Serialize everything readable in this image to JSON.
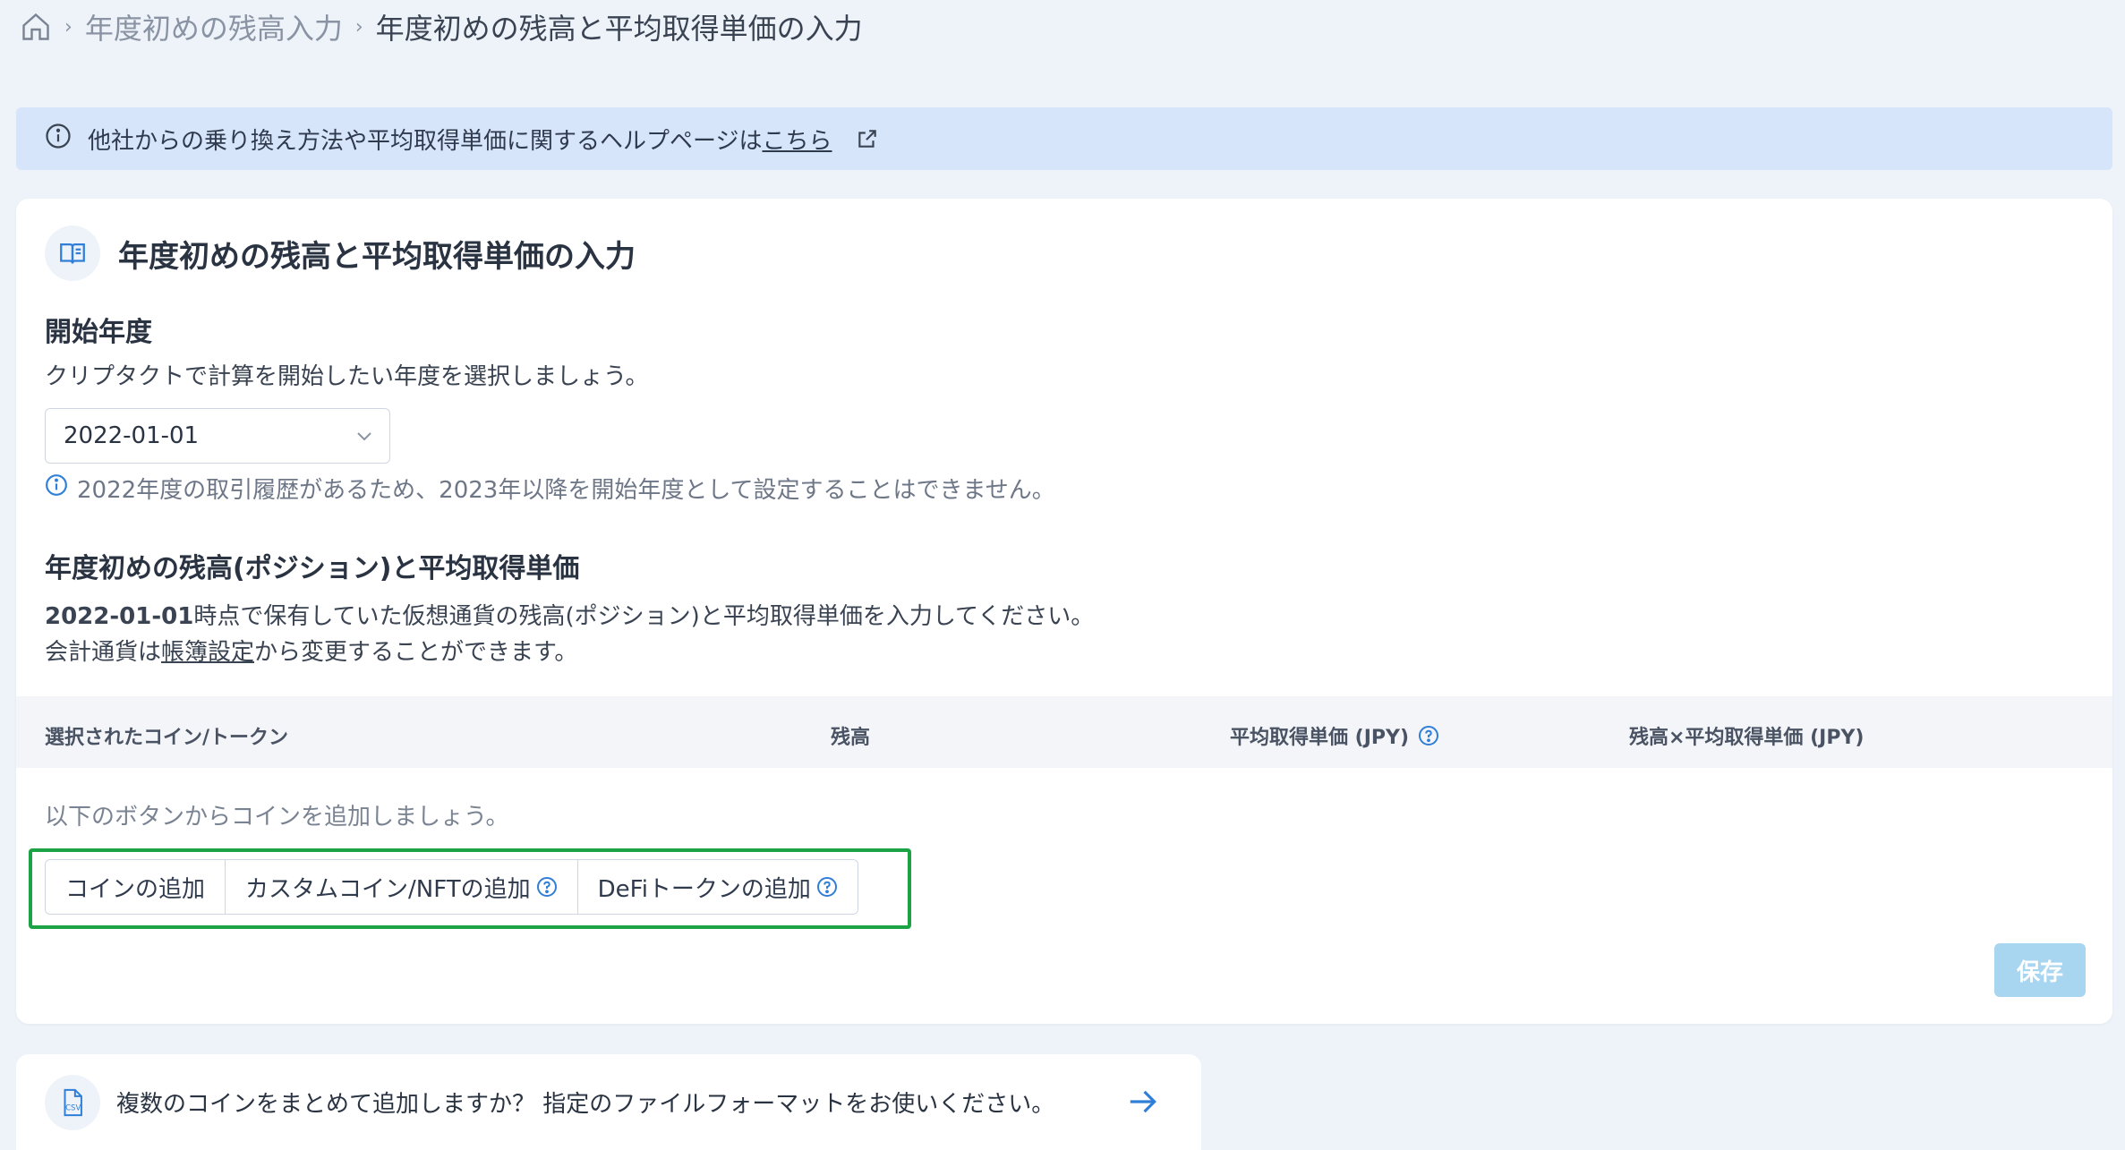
{
  "breadcrumb": {
    "level1": "年度初めの残高入力",
    "current": "年度初めの残高と平均取得単価の入力"
  },
  "banner": {
    "text": "他社からの乗り換え方法や平均取得単価に関するヘルプページは",
    "link": "こちら"
  },
  "card": {
    "title": "年度初めの残高と平均取得単価の入力",
    "start_year": {
      "heading": "開始年度",
      "description": "クリプタクトで計算を開始したい年度を選択しましょう。",
      "selected": "2022-01-01",
      "note": "2022年度の取引履歴があるため、2023年以降を開始年度として設定することはできません。"
    },
    "positions": {
      "heading": "年度初めの残高(ポジション)と平均取得単価",
      "date": "2022-01-01",
      "description_rest": "時点で保有していた仮想通貨の残高(ポジション)と平均取得単価を入力してください。",
      "currency_prefix": "会計通貨は",
      "currency_link": "帳簿設定",
      "currency_suffix": "から変更することができます。"
    },
    "table": {
      "col_coin": "選択されたコイン/トークン",
      "col_balance": "残高",
      "col_avg_price": "平均取得単価 (JPY)",
      "col_total": "残高×平均取得単価 (JPY)",
      "empty": "以下のボタンからコインを追加しましょう。"
    },
    "buttons": {
      "add_coin": "コインの追加",
      "add_custom": "カスタムコイン/NFTの追加",
      "add_defi": "DeFiトークンの追加",
      "save": "保存"
    }
  },
  "csv": {
    "text": "複数のコインをまとめて追加しますか？ 指定のファイルフォーマットをお使いください。",
    "badge": "CSV"
  },
  "colors": {
    "accent": "#2f7fd8",
    "highlight": "#1ba346",
    "save_disabled": "#a8d6f0"
  }
}
